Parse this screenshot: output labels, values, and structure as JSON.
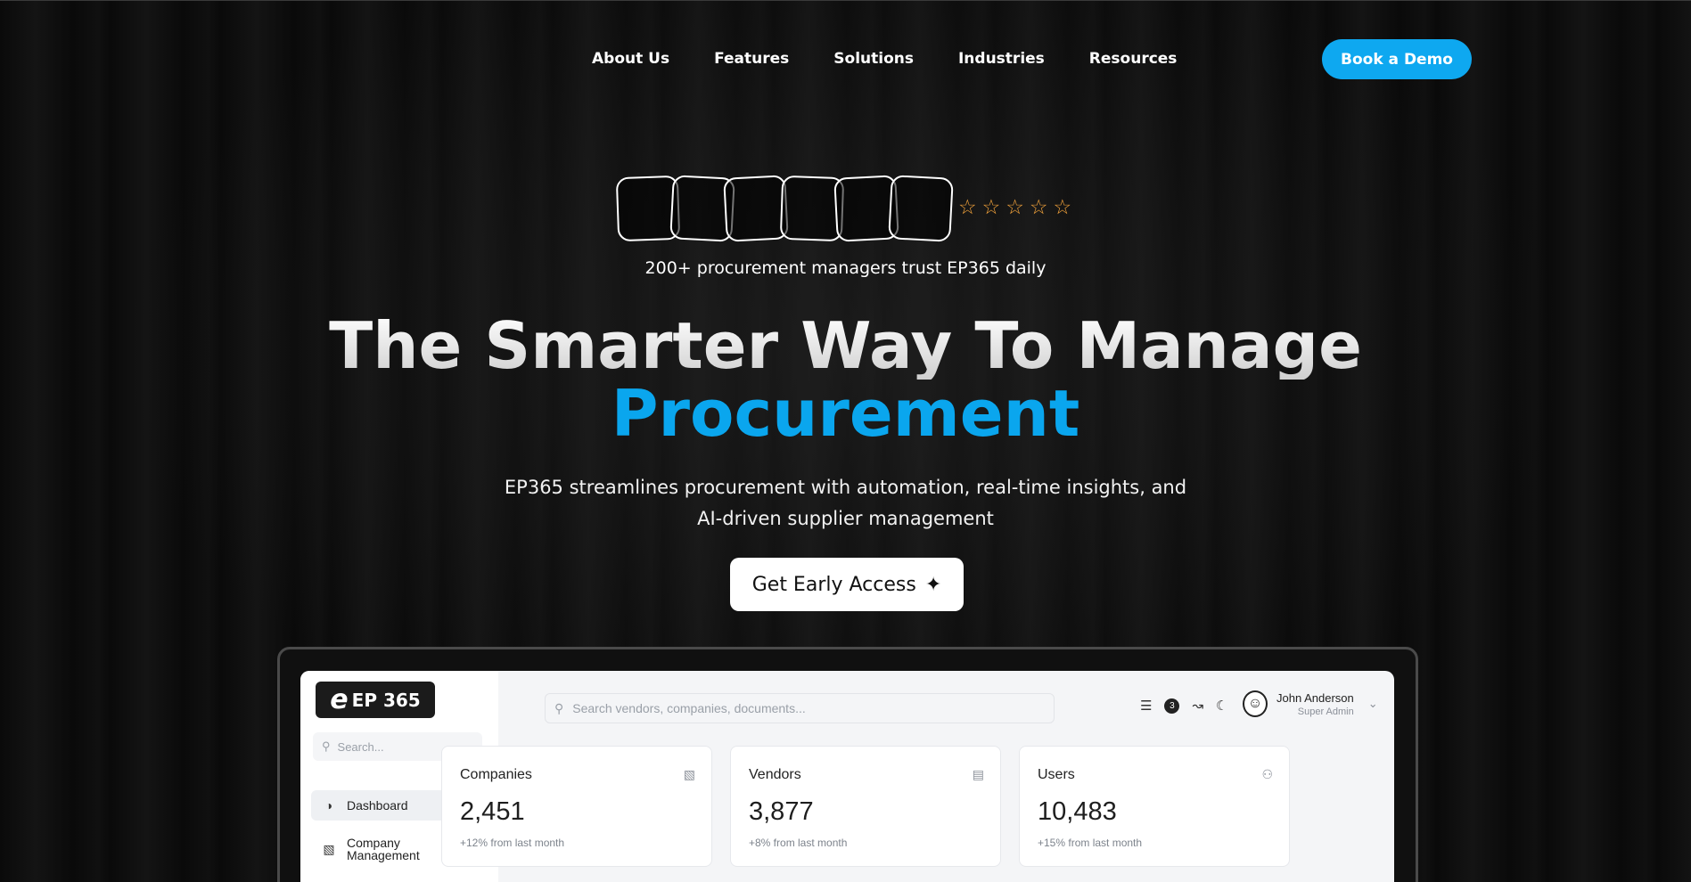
{
  "nav": {
    "links": [
      "About Us",
      "Features",
      "Solutions",
      "Industries",
      "Resources"
    ],
    "demo_button": "Book a Demo"
  },
  "hero": {
    "rating_stars": 5,
    "trust_text": "200+ procurement managers trust EP365 daily",
    "headline": "The Smarter Way To Manage",
    "headline_accent": "Procurement",
    "subtitle_line1": "EP365 streamlines procurement with automation, real-time insights, and",
    "subtitle_line2": "AI-driven supplier management",
    "cta_label": "Get Early Access",
    "accent_color": "#0aa6ee",
    "star_color": "#f3a33b"
  },
  "dashboard": {
    "logo_text": "EP 365",
    "side_search_placeholder": "Search...",
    "side_items": [
      {
        "label": "Dashboard",
        "icon": "gauge-icon"
      },
      {
        "label_line1": "Company",
        "label_line2": "Management",
        "icon": "building-icon"
      }
    ],
    "search_placeholder": "Search vendors, companies, documents...",
    "notification_count": "3",
    "user": {
      "name": "John Anderson",
      "role": "Super Admin"
    },
    "cards": [
      {
        "title": "Companies",
        "value": "2,451",
        "change": "+12% from last month",
        "icon": "building-icon"
      },
      {
        "title": "Vendors",
        "value": "3,877",
        "change": "+8% from last month",
        "icon": "store-icon"
      },
      {
        "title": "Users",
        "value": "10,483",
        "change": "+15% from last month",
        "icon": "users-icon"
      }
    ]
  }
}
